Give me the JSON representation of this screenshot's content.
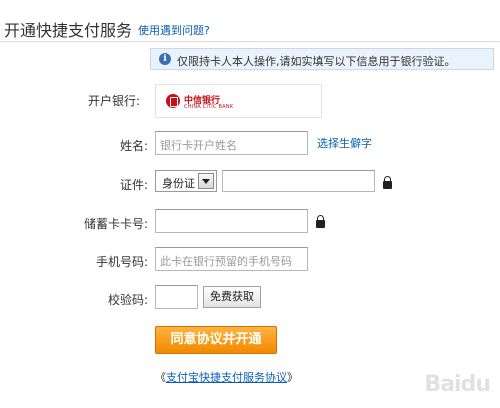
{
  "header": {
    "title": "开通快捷支付服务",
    "help_link": "使用遇到问题?"
  },
  "notice": {
    "icon": "info-icon",
    "text": "仅限持卡人本人操作,请如实填写以下信息用于银行验证。"
  },
  "form": {
    "bank": {
      "label": "开户银行:",
      "name": "中信银行",
      "name_en": "CHINA CITIC BANK"
    },
    "name": {
      "label": "姓名:",
      "placeholder": "银行卡开户姓名",
      "rare_char_link": "选择生僻字"
    },
    "id": {
      "label": "证件:",
      "type_selected": "身份证"
    },
    "card": {
      "label": "储蓄卡卡号:"
    },
    "phone": {
      "label": "手机号码:",
      "placeholder": "此卡在银行预留的手机号码"
    },
    "code": {
      "label": "校验码:",
      "button": "免费获取"
    }
  },
  "submit": {
    "label": "同意协议并开通"
  },
  "agreement": {
    "open": "《",
    "link": "支付宝快捷支付服务协议",
    "close": "》"
  },
  "watermark": {
    "text": "Baidu"
  },
  "colors": {
    "link": "#0a5fb4",
    "submit": "#f18a00",
    "bank_red": "#c4121a"
  }
}
